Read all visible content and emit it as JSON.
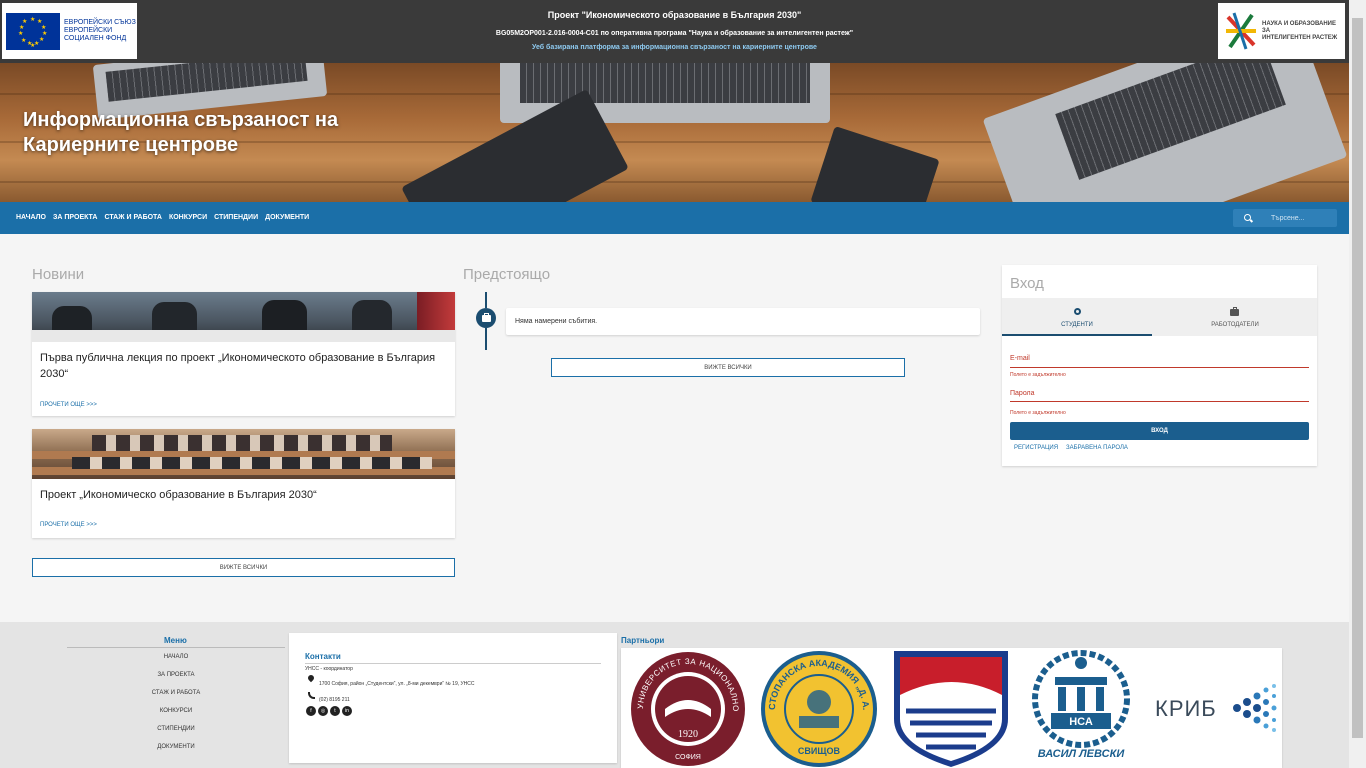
{
  "topbar": {
    "eu_logo_text": [
      "ЕВРОПЕЙСКИ СЪЮЗ",
      "ЕВРОПЕЙСКИ",
      "СОЦИАЛЕН ФОНД"
    ],
    "title": "Проект \"Икономическото образование в България 2030\"",
    "program": "BG05M2OP001-2.016-0004-C01 по оперативна програма \"Наука и образование за интелигентен растеж\"",
    "platform": "Уеб базирана платформа за информационна свързаност на кариерните центрове",
    "nauka_logo_text": [
      "НАУКА И ОБРАЗОВАНИЕ ЗА",
      "ИНТЕЛИГЕНТЕН РАСТЕЖ"
    ]
  },
  "hero": {
    "title_line1": "Информационна свързаност на",
    "title_line2": "Кариерните центрове"
  },
  "nav": {
    "items": [
      "НАЧАЛО",
      "ЗА ПРОЕКТА",
      "СТАЖ И РАБОТА",
      "КОНКУРСИ",
      "СТИПЕНДИИ",
      "ДОКУМЕНТИ"
    ],
    "search_placeholder": "Търсене..."
  },
  "news": {
    "heading": "Новини",
    "items": [
      {
        "title": "Първа публична лекция по проект „Икономическото образование в България 2030“",
        "read_more": "ПРОЧЕТИ ОЩЕ >>>"
      },
      {
        "title": "Проект „Икономическо образование в България 2030“",
        "read_more": "ПРОЧЕТИ ОЩЕ >>>"
      }
    ],
    "view_all": "ВИЖТЕ ВСИЧКИ"
  },
  "upcoming": {
    "heading": "Предстоящо",
    "empty_text": "Няма намерени събития.",
    "view_all": "ВИЖТЕ ВСИЧКИ"
  },
  "login": {
    "heading": "Вход",
    "tab_students": "СТУДЕНТИ",
    "tab_employers": "РАБОТОДАТЕЛИ",
    "email_label": "E-mail",
    "email_error": "Полето е задължително",
    "password_label": "Парола",
    "password_error": "Полето е задължително",
    "submit": "ВХОД",
    "register": "РЕГИСТРАЦИЯ",
    "forgot": "ЗАБРАВЕНА ПАРОЛА"
  },
  "footer": {
    "menu_heading": "Меню",
    "menu_items": [
      "НАЧАЛО",
      "ЗА ПРОЕКТА",
      "СТАЖ И РАБОТА",
      "КОНКУРСИ",
      "СТИПЕНДИИ",
      "ДОКУМЕНТИ"
    ],
    "contacts_heading": "Контакти",
    "coordinator": "УНСС - координатор",
    "address": "1700 София, район „Студентски“, ул. „8-ми декември“ № 19, УНСС",
    "phone": "(02) 8195 211",
    "social": [
      "f",
      "◎",
      "t",
      "in"
    ],
    "partners_heading": "Партньори",
    "partners": {
      "unwe_year": "1920",
      "unwe_city": "СОФИЯ",
      "unwe_ring": "УНИВЕРСИТЕТ ЗА НАЦИОНАЛНО И СВЕТОВНО СТОПАНСТВО",
      "tsenov_ring": "СТОПАНСКА АКАДЕМИЯ „Д. А. ЦЕНОВ“",
      "tsenov_city": "СВИЩОВ",
      "nsa_abbr": "НСА",
      "nsa_name": "ВАСИЛ ЛЕВСКИ",
      "krib": "КРИБ"
    }
  },
  "colors": {
    "primary": "#1b6fa8",
    "dark_bar": "#3a3a3a",
    "error": "#c0392b",
    "accent_dark": "#1b4d70"
  }
}
